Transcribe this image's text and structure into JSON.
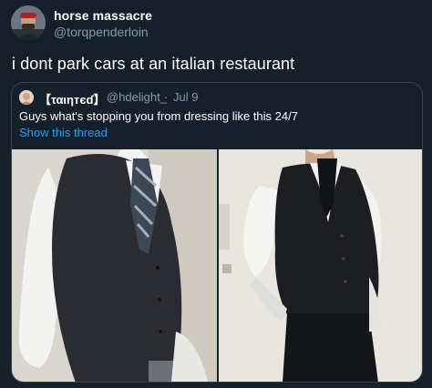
{
  "tweet": {
    "author_name": "horse massacre",
    "author_handle": "@torqpenderloin",
    "text": "i dont park cars at an italian restaurant"
  },
  "quoted_tweet": {
    "author_name": "【ταιηтєɗ】",
    "author_handle": "@hdelight_",
    "separator": "·",
    "date": "Jul 9",
    "text": "Guys what's stopping you from dressing like this 24/7",
    "thread_link": "Show this thread",
    "link_color": "#1da1f2"
  },
  "colors": {
    "background": "#15202b",
    "secondary_text": "#8899a6",
    "border": "#38444d"
  },
  "icons": {
    "author_avatar": "avatar-icon",
    "quoted_avatar": "avatar-icon"
  }
}
